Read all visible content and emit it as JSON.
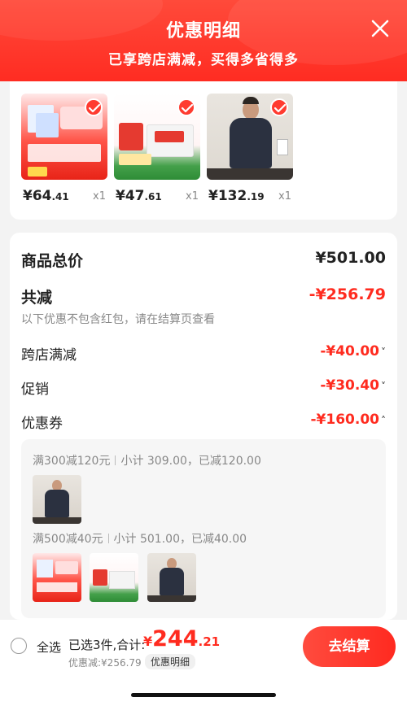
{
  "header": {
    "title": "优惠明细",
    "subtitle": "已享跨店满减，买得多省得多",
    "close_icon": "close-icon"
  },
  "products": [
    {
      "price_int": "¥64",
      "price_dec": ".41",
      "qty": "x1",
      "image": "towel-product-image"
    },
    {
      "price_int": "¥47",
      "price_dec": ".61",
      "qty": "x1",
      "image": "medical-box-image"
    },
    {
      "price_int": "¥132",
      "price_dec": ".19",
      "qty": "x1",
      "image": "sweater-model-image"
    }
  ],
  "summary": {
    "total_label": "商品总价",
    "total_value": "¥501.00",
    "reduce_label": "共减",
    "reduce_value": "-¥256.79",
    "note": "以下优惠不包含红包，请在结算页查看",
    "items": [
      {
        "label": "跨店满减",
        "value": "-¥40.00",
        "chevron": "chevron-down-icon"
      },
      {
        "label": "促销",
        "value": "-¥30.40",
        "chevron": "chevron-down-icon"
      },
      {
        "label": "优惠券",
        "value": "-¥160.00",
        "chevron": "chevron-up-icon"
      }
    ]
  },
  "coupons": [
    {
      "rule": "满300减120元",
      "subtotal": "小计 309.00，已减120.00"
    },
    {
      "rule": "满500减40元",
      "subtotal": "小计 501.00，已减40.00"
    }
  ],
  "bottom": {
    "select_all": "全选",
    "selected": "已选3件,合计:",
    "sum_currency": "¥",
    "sum_int": "244",
    "sum_dec": ".21",
    "discount": "优惠减:¥256.79",
    "detail_button": "优惠明细",
    "checkout_button": "去结算"
  },
  "colors": {
    "accent": "#ff2b1f",
    "header": "#ff3a2d"
  }
}
